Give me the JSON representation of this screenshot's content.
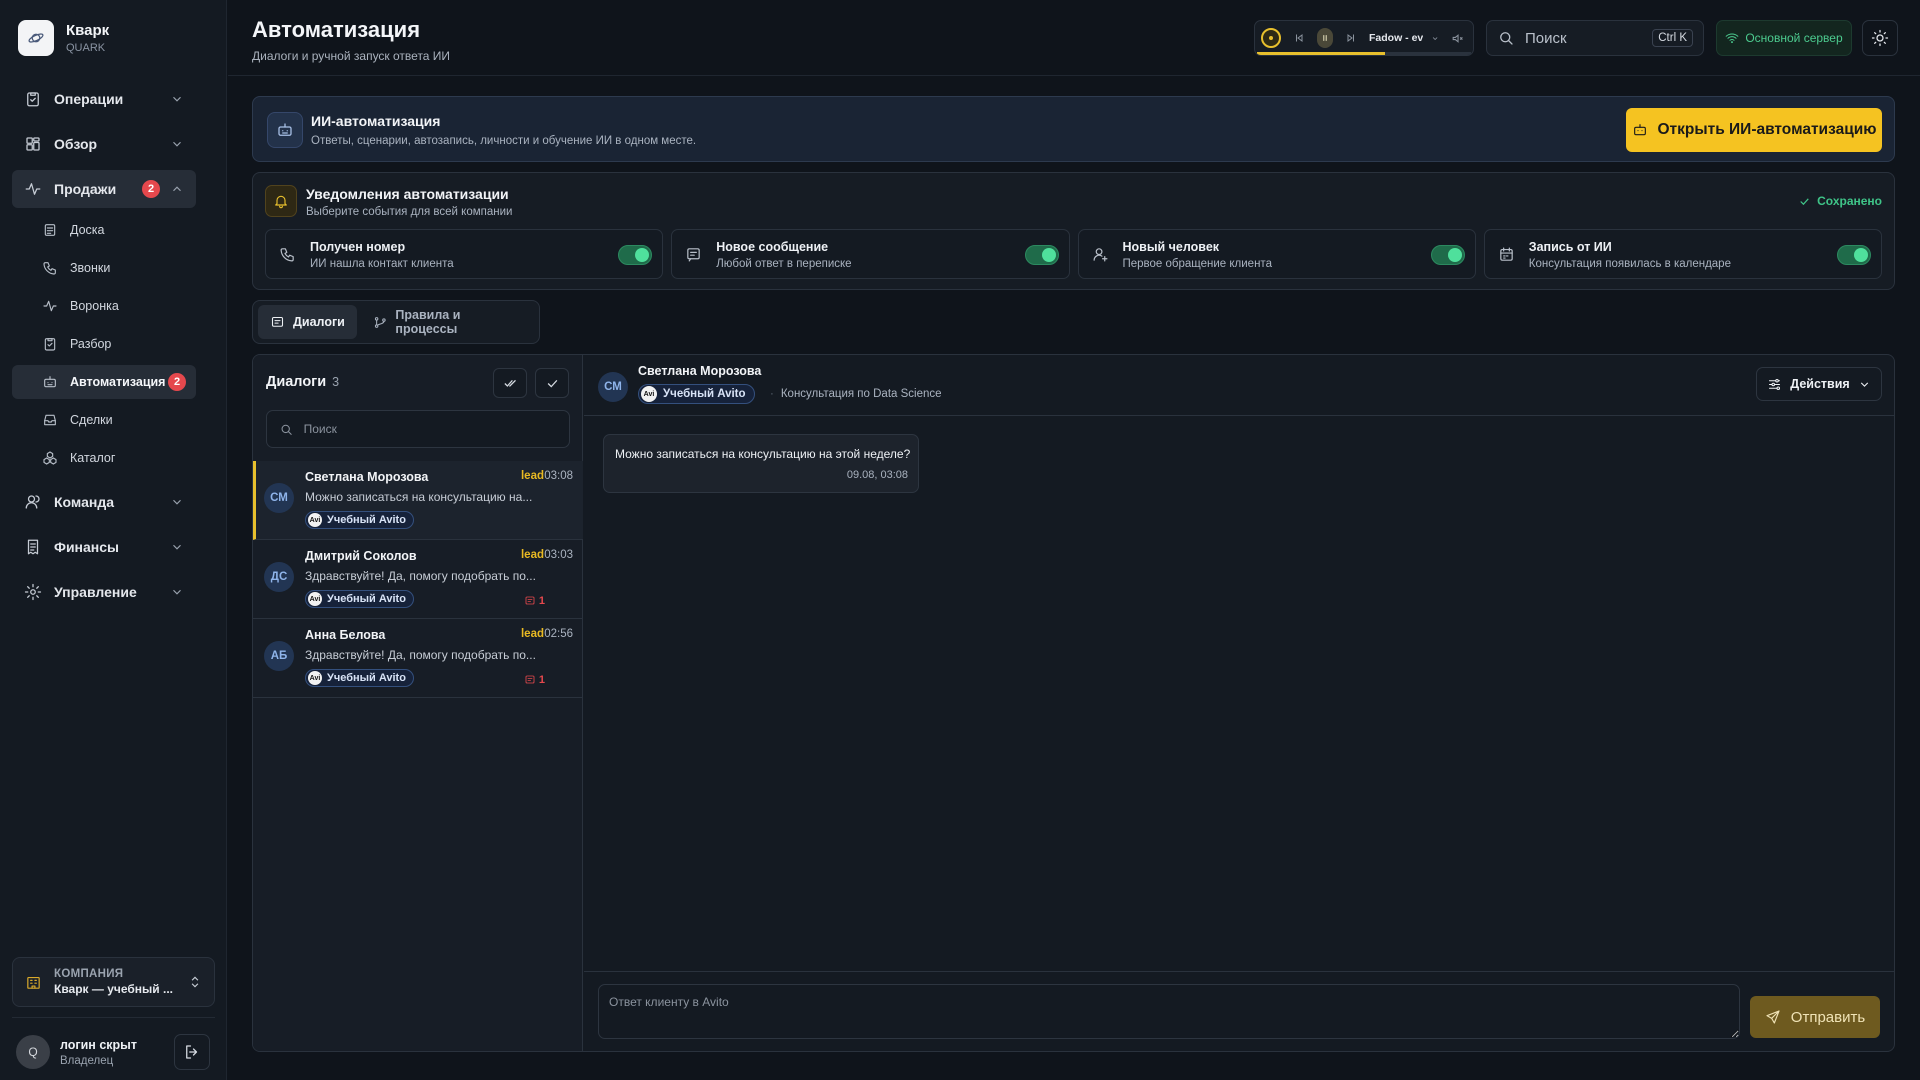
{
  "brand": {
    "name": "Кварк",
    "sub": "QUARK"
  },
  "nav": {
    "operations": "Операции",
    "overview": "Обзор",
    "sales": "Продажи",
    "sales_badge": "2",
    "sales_sub": [
      {
        "label": "Доска",
        "icon": "board-icon"
      },
      {
        "label": "Звонки",
        "icon": "phone-icon"
      },
      {
        "label": "Воронка",
        "icon": "pulse-icon"
      },
      {
        "label": "Разбор",
        "icon": "clipboard-icon"
      },
      {
        "label": "Автоматизация",
        "icon": "robot-icon",
        "badge": "2",
        "active": true
      },
      {
        "label": "Сделки",
        "icon": "inbox-icon"
      },
      {
        "label": "Каталог",
        "icon": "boxes-icon"
      }
    ],
    "team": "Команда",
    "finance": "Финансы",
    "management": "Управление"
  },
  "company": {
    "title": "КОМПАНИЯ",
    "name": "Кварк — учебный ..."
  },
  "user": {
    "name": "логин скрыт",
    "role": "Владелец",
    "initial": "Q"
  },
  "header": {
    "title": "Автоматизация",
    "subtitle": "Диалоги и ручной запуск ответа ИИ",
    "player_track": "Fadow - eve...",
    "player_progress": 0.6,
    "search_placeholder": "Поиск",
    "search_kbd": "Ctrl K",
    "server": "Основной сервер"
  },
  "ai_banner": {
    "title": "ИИ-автоматизация",
    "subtitle": "Ответы, сценарии, автозапись, личности и обучение ИИ в одном месте.",
    "button": "Открыть ИИ-автоматизацию"
  },
  "notifications": {
    "title": "Уведомления автоматизации",
    "subtitle": "Выберите события для всей компании",
    "saved": "Сохранено",
    "cards": [
      {
        "title": "Получен номер",
        "sub": "ИИ нашла контакт клиента",
        "enabled": true
      },
      {
        "title": "Новое сообщение",
        "sub": "Любой ответ в переписке",
        "enabled": true
      },
      {
        "title": "Новый человек",
        "sub": "Первое обращение клиента",
        "enabled": true
      },
      {
        "title": "Запись от ИИ",
        "sub": "Консультация появилась в календаре",
        "enabled": true
      }
    ]
  },
  "tabs": {
    "dialogs": "Диалоги",
    "rules": "Правила и процессы"
  },
  "dialogs": {
    "title": "Диалоги",
    "count": "3",
    "search_placeholder": "Поиск",
    "items": [
      {
        "initials": "СМ",
        "name": "Светлана Морозова",
        "status": "lead",
        "time": "03:08",
        "message": "Можно записаться на консультацию на...",
        "source": "Учебный Avito",
        "unread": ""
      },
      {
        "initials": "ДС",
        "name": "Дмитрий Соколов",
        "status": "lead",
        "time": "03:03",
        "message": "Здравствуйте! Да, помогу подобрать по...",
        "source": "Учебный Avito",
        "unread": "1"
      },
      {
        "initials": "АБ",
        "name": "Анна Белова",
        "status": "lead",
        "time": "02:56",
        "message": "Здравствуйте! Да, помогу подобрать по...",
        "source": "Учебный Avito",
        "unread": "1"
      }
    ]
  },
  "chat": {
    "initials": "СМ",
    "name": "Светлана Морозова",
    "source": "Учебный Avito",
    "avito_logo": "Avi",
    "topic": "Консультация по Data Science",
    "actions": "Действия",
    "message": {
      "text": "Можно записаться на консультацию на этой неделе?",
      "time": "09.08, 03:08"
    },
    "composer_placeholder": "Ответ клиенту в Avito",
    "send": "Отправить"
  }
}
